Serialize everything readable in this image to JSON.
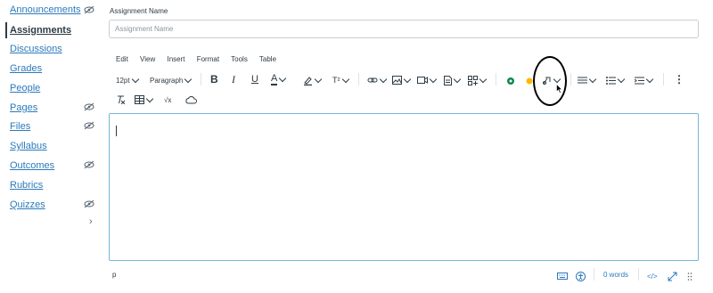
{
  "sidebar": {
    "items": [
      {
        "label": "Announcements",
        "state": "link",
        "hidden_icon": true
      },
      {
        "label": "Assignments",
        "state": "active",
        "hidden_icon": false
      },
      {
        "label": "Discussions",
        "state": "link",
        "hidden_icon": false
      },
      {
        "label": "Grades",
        "state": "link",
        "hidden_icon": false
      },
      {
        "label": "People",
        "state": "link",
        "hidden_icon": false
      },
      {
        "label": "Pages",
        "state": "link",
        "hidden_icon": true
      },
      {
        "label": "Files",
        "state": "link",
        "hidden_icon": true
      },
      {
        "label": "Syllabus",
        "state": "link",
        "hidden_icon": false
      },
      {
        "label": "Outcomes",
        "state": "link",
        "hidden_icon": true
      },
      {
        "label": "Rubrics",
        "state": "link",
        "hidden_icon": false
      },
      {
        "label": "Quizzes",
        "state": "link",
        "hidden_icon": true
      }
    ],
    "collapse_glyph": "›"
  },
  "form": {
    "name_label": "Assignment Name",
    "name_placeholder": "Assignment Name",
    "name_value": ""
  },
  "editor": {
    "menu": [
      "Edit",
      "View",
      "Insert",
      "Format",
      "Tools",
      "Table"
    ],
    "font_size": "12pt",
    "block_format": "Paragraph",
    "bold": "B",
    "italic": "I",
    "underline": "U",
    "font_color": "A",
    "superscript": "T²",
    "more": "⋮",
    "math": "√x",
    "status_path": "p",
    "word_count": "0 words",
    "html_toggle": "</>"
  },
  "colors": {
    "link": "#2b7abc",
    "text": "#2d3b45",
    "green_icon": "#0b874b",
    "yellow_icon": "#fcb900",
    "focus_border": "#74b6d9"
  }
}
